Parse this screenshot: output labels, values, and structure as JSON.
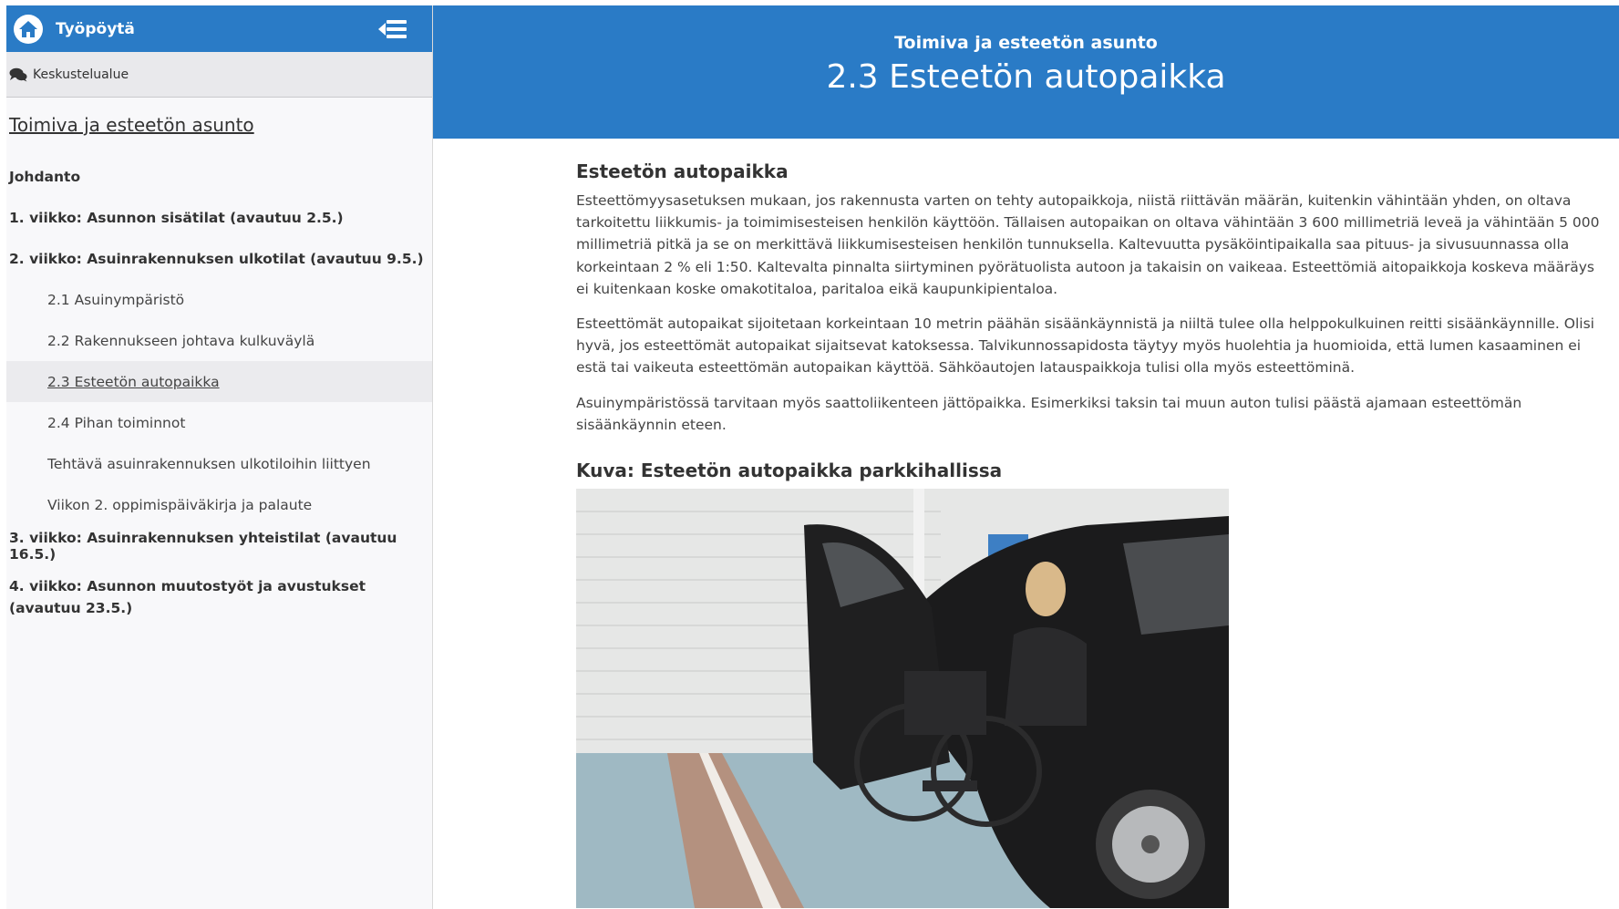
{
  "sidebar": {
    "top_title": "Työpöytä",
    "forum_label": "Keskustelualue",
    "course_link": "Toimiva ja esteetön asunto",
    "items": [
      {
        "label": "Johdanto"
      },
      {
        "label": "1. viikko: Asunnon sisätilat (avautuu 2.5.)"
      },
      {
        "label": "2. viikko: Asuinrakennuksen ulkotilat (avautuu 9.5.)"
      },
      {
        "label": "2.1 Asuinympäristö"
      },
      {
        "label": "2.2 Rakennukseen johtava kulkuväylä"
      },
      {
        "label": "2.3 Esteetön autopaikka"
      },
      {
        "label": "2.4 Pihan toiminnot"
      },
      {
        "label": "Tehtävä asuinrakennuksen ulkotiloihin liittyen"
      },
      {
        "label": "Viikon 2. oppimispäiväkirja ja palaute"
      },
      {
        "label": "3. viikko: Asuinrakennuksen yhteistilat (avautuu 16.5.)"
      },
      {
        "label": "4. viikko: Asunnon muutostyöt ja avustukset (avautuu 23.5.)"
      }
    ]
  },
  "header": {
    "kicker": "Toimiva ja esteetön asunto",
    "title": "2.3 Esteetön autopaikka"
  },
  "content": {
    "heading": "Esteetön autopaikka",
    "paragraphs": [
      "Esteettömyysasetuksen mukaan, jos rakennusta varten on tehty autopaikkoja, niistä riittävän määrän, kuitenkin vähintään yhden, on oltava tarkoitettu liikkumis- ja toimimisesteisen henkilön käyttöön. Tällaisen autopaikan on oltava vähintään 3 600 millimetriä leveä ja vähintään 5 000 millimetriä pitkä ja se on merkittävä liikkumisesteisen henkilön tunnuksella. Kaltevuutta pysäköintipaikalla saa pituus- ja sivusuunnassa olla korkeintaan 2 % eli 1:50. Kaltevalta pinnalta siirtyminen pyörätuolista autoon ja takaisin on vaikeaa. Esteettömiä aitopaikkoja koskeva määräys ei kuitenkaan koske omakotitaloa, paritaloa eikä kaupunkipientaloa.",
      "Esteettömät autopaikat sijoitetaan korkeintaan 10 metrin päähän sisäänkäynnistä ja niiltä tulee olla helppokulkuinen reitti sisäänkäynnille. Olisi hyvä, jos esteettömät autopaikat sijaitsevat katoksessa. Talvikunnossapidosta täytyy myös huolehtia ja huomioida, että lumen kasaaminen ei estä tai vaikeuta esteettömän autopaikan käyttöä. Sähköautojen latauspaikkoja tulisi olla myös esteettöminä.",
      "Asuinympäristössä tarvitaan myös saattoliikenteen jättöpaikka. Esimerkiksi taksin tai muun auton tulisi päästä ajamaan esteettömän sisäänkäynnin eteen."
    ],
    "figure_heading": "Kuva: Esteetön autopaikka parkkihallissa"
  },
  "colors": {
    "accent": "#2a7bc6",
    "sidebar_bg": "#f8f8fa",
    "active_item_bg": "#ebebee"
  },
  "icons": {
    "home": "home-icon",
    "collapse": "collapse-menu-icon",
    "forum": "chat-bubbles-icon"
  }
}
